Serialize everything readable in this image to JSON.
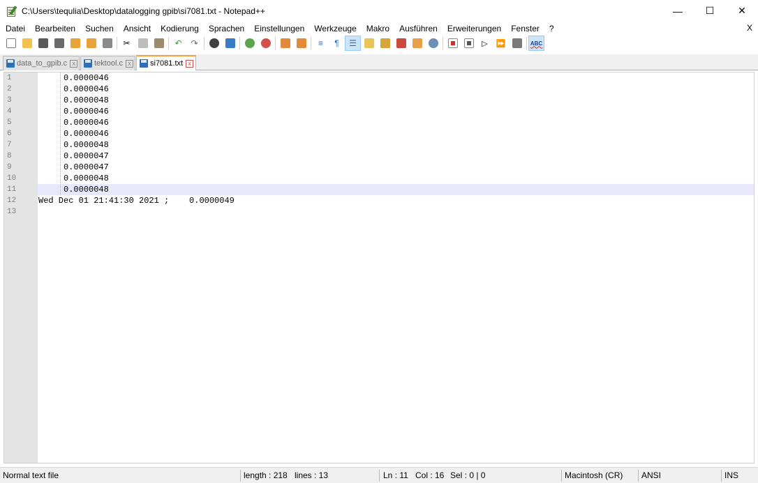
{
  "window": {
    "title": "C:\\Users\\tequlia\\Desktop\\datalogging gpib\\si7081.txt - Notepad++",
    "minimize": "—",
    "maximize": "☐",
    "close": "✕"
  },
  "menu": {
    "items": [
      "Datei",
      "Bearbeiten",
      "Suchen",
      "Ansicht",
      "Kodierung",
      "Sprachen",
      "Einstellungen",
      "Werkzeuge",
      "Makro",
      "Ausführen",
      "Erweiterungen",
      "Fenster",
      "?"
    ],
    "close_doc": "X"
  },
  "toolbar": {
    "icons": [
      "new-file-icon",
      "open-file-icon",
      "save-icon",
      "save-all-icon",
      "close-icon",
      "close-all-icon",
      "print-icon",
      "cut-icon",
      "copy-icon",
      "paste-icon",
      "undo-icon",
      "redo-icon",
      "find-icon",
      "replace-icon",
      "zoom-in-icon",
      "zoom-out-icon",
      "sync-vertical-icon",
      "sync-horizontal-icon",
      "word-wrap-icon",
      "show-all-chars-icon",
      "indent-guide-icon",
      "user-defined-lang-icon",
      "doc-map-icon",
      "function-list-icon",
      "folder-workspace-icon",
      "monitoring-icon",
      "record-macro-icon",
      "stop-record-icon",
      "play-macro-icon",
      "run-macro-multiple-icon",
      "save-macro-icon",
      "spell-check-icon"
    ],
    "active_icon": "indent-guide-icon",
    "spellcheck_label": "ABC"
  },
  "tabs": [
    {
      "label": "data_to_gpib.c",
      "close": "x",
      "active": false
    },
    {
      "label": "tektool.c",
      "close": "x",
      "active": false
    },
    {
      "label": "si7081.txt",
      "close": "x",
      "active": true
    }
  ],
  "editor": {
    "line_numbers": [
      "1",
      "2",
      "3",
      "4",
      "5",
      "6",
      "7",
      "8",
      "9",
      "10",
      "11",
      "12",
      "13"
    ],
    "lines": [
      "\t0.0000046",
      "\t0.0000046",
      "\t0.0000048",
      "\t0.0000046",
      "\t0.0000046",
      "\t0.0000046",
      "\t0.0000048",
      "\t0.0000047",
      "\t0.0000047",
      "\t0.0000048",
      "\t0.0000048",
      "Wed Dec 01 21:41:30 2021 ;\t0.0000049",
      ""
    ],
    "current_line": 11
  },
  "status": {
    "file_type": "Normal text file",
    "length": "length : 218",
    "lines": "lines : 13",
    "ln": "Ln : 11",
    "col": "Col : 16",
    "sel": "Sel : 0 | 0",
    "eol": "Macintosh (CR)",
    "encoding": "ANSI",
    "mode": "INS"
  },
  "colors": {
    "current_line": "#e8e8ff",
    "gutter": "#e4e4e4",
    "active_tab_accent": "#f8a23a"
  }
}
